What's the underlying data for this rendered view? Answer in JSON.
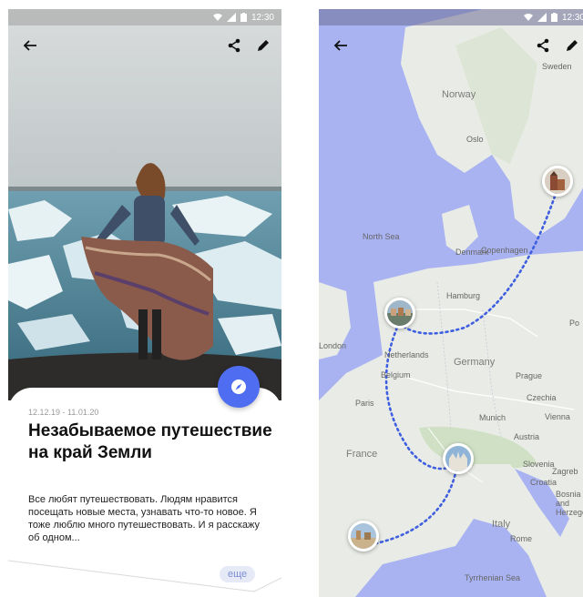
{
  "status_bar": {
    "time": "12:30"
  },
  "story": {
    "dates": "12.12.19 - 11.01.20",
    "title": "Незабываемое путешествие на край Земли",
    "description": "Все любят путешествовать. Людям нравится посещать новые места, узнавать что-то новое. Я тоже люблю много путешествовать. И я расскажу об одном...",
    "more_label": "еще"
  },
  "map": {
    "labels": {
      "norway": "Norway",
      "sweden": "Sweden",
      "north_sea": "North Sea",
      "germany": "Germany",
      "france": "France",
      "italy": "Italy",
      "denmark": "Denmark",
      "netherlands": "Netherlands",
      "belgium": "Belgium",
      "paris": "Paris",
      "prague": "Prague",
      "czechia": "Czechia",
      "munich": "Munich",
      "vienna": "Vienna",
      "austria": "Austria",
      "slovenia": "Slovenia",
      "zagreb": "Zagreb",
      "croatia": "Croatia",
      "rome": "Rome",
      "hamburg": "Hamburg",
      "copenhagen": "Copenhagen",
      "oslo": "Oslo",
      "london": "London",
      "bosnia": "Bosnia and Herzegovina",
      "po": "Po",
      "tyrrhenian": "Tyrrhenian Sea"
    }
  },
  "colors": {
    "accent": "#4f6df0",
    "route": "#3f5fe0"
  }
}
